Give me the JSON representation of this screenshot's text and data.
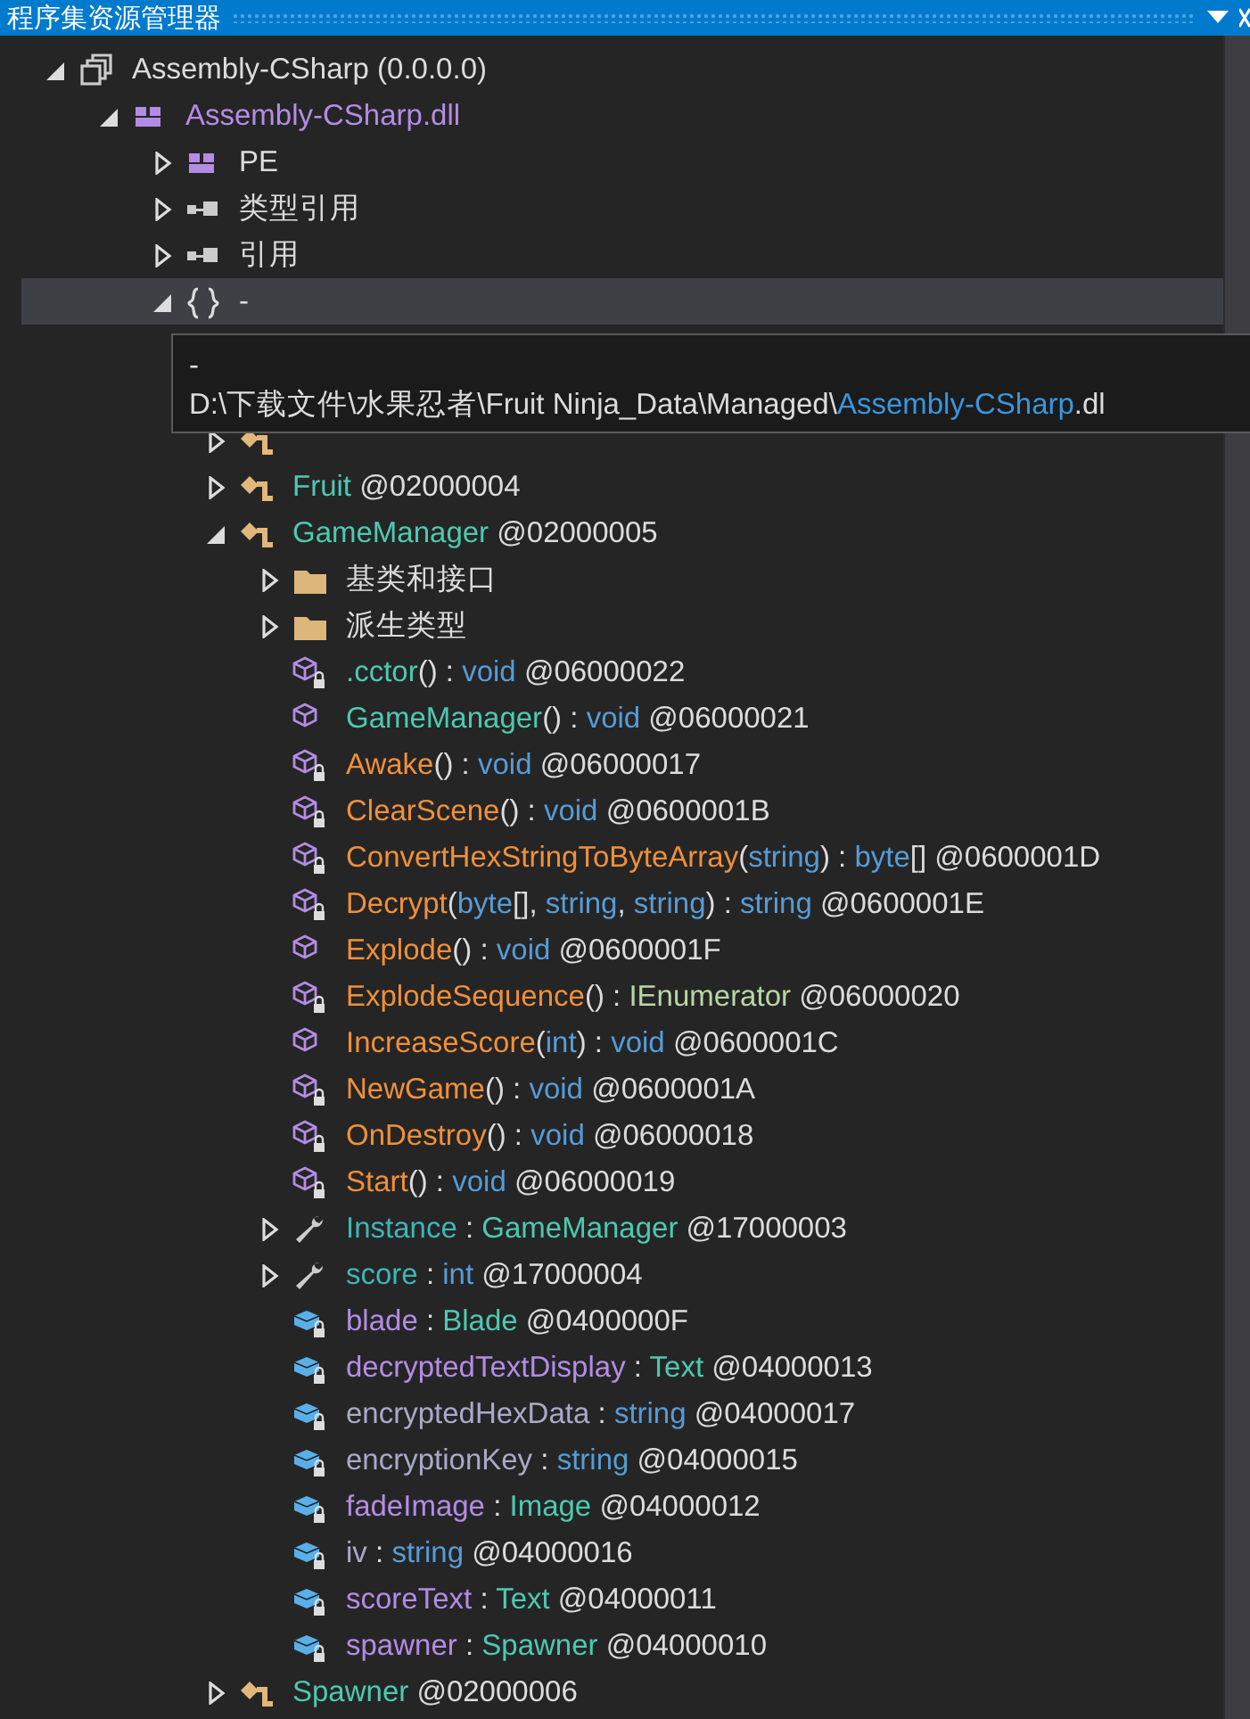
{
  "window": {
    "title": "程序集资源管理器"
  },
  "tree": [
    {
      "kind": "assembly",
      "expanded": true,
      "selected": false,
      "label": [
        {
          "t": "Assembly-CSharp (0.0.0.0)",
          "kind": "plain"
        }
      ],
      "children": [
        {
          "kind": "module",
          "expanded": true,
          "selected": false,
          "label": [
            {
              "t": "Assembly-CSharp.dll",
              "kind": "field"
            }
          ],
          "children": [
            {
              "kind": "module",
              "expanded": false,
              "selected": false,
              "label": [
                {
                  "t": "PE",
                  "kind": "plain"
                }
              ]
            },
            {
              "kind": "refs",
              "expanded": false,
              "selected": false,
              "label": [
                {
                  "t": "类型引用",
                  "kind": "plain"
                }
              ]
            },
            {
              "kind": "refs",
              "expanded": false,
              "selected": false,
              "label": [
                {
                  "t": "引用",
                  "kind": "plain"
                }
              ]
            },
            {
              "kind": "namespace",
              "expanded": true,
              "selected": true,
              "label": [
                {
                  "t": "-",
                  "kind": "plain"
                }
              ],
              "children": [
                {
                  "kind": "class",
                  "expanded": false,
                  "selected": false
                },
                {
                  "kind": "class",
                  "expanded": false,
                  "selected": false,
                  "label": [
                    {
                      "t": "Fruit",
                      "kind": "type"
                    },
                    {
                      "t": " @02000004",
                      "kind": "plain"
                    }
                  ]
                },
                {
                  "kind": "class",
                  "expanded": true,
                  "selected": false,
                  "label": [
                    {
                      "t": "GameManager",
                      "kind": "type"
                    },
                    {
                      "t": " @02000005",
                      "kind": "plain"
                    }
                  ],
                  "children": [
                    {
                      "kind": "folder",
                      "expanded": false,
                      "selected": false,
                      "label": [
                        {
                          "t": "基类和接口",
                          "kind": "plain"
                        }
                      ]
                    },
                    {
                      "kind": "folder",
                      "expanded": false,
                      "selected": false,
                      "label": [
                        {
                          "t": "派生类型",
                          "kind": "plain"
                        }
                      ]
                    },
                    {
                      "kind": "method",
                      "locked": true,
                      "selected": false,
                      "label": [
                        {
                          "t": ".cctor",
                          "kind": "type"
                        },
                        {
                          "t": "() : ",
                          "kind": "plain"
                        },
                        {
                          "t": "void",
                          "kind": "keyword"
                        },
                        {
                          "t": " @06000022",
                          "kind": "plain"
                        }
                      ]
                    },
                    {
                      "kind": "method",
                      "locked": false,
                      "selected": false,
                      "label": [
                        {
                          "t": "GameManager",
                          "kind": "type"
                        },
                        {
                          "t": "() : ",
                          "kind": "plain"
                        },
                        {
                          "t": "void",
                          "kind": "keyword"
                        },
                        {
                          "t": " @06000021",
                          "kind": "plain"
                        }
                      ]
                    },
                    {
                      "kind": "method",
                      "locked": true,
                      "selected": false,
                      "label": [
                        {
                          "t": "Awake",
                          "kind": "method"
                        },
                        {
                          "t": "() : ",
                          "kind": "plain"
                        },
                        {
                          "t": "void",
                          "kind": "keyword"
                        },
                        {
                          "t": " @06000017",
                          "kind": "plain"
                        }
                      ]
                    },
                    {
                      "kind": "method",
                      "locked": true,
                      "selected": false,
                      "label": [
                        {
                          "t": "ClearScene",
                          "kind": "method"
                        },
                        {
                          "t": "() : ",
                          "kind": "plain"
                        },
                        {
                          "t": "void",
                          "kind": "keyword"
                        },
                        {
                          "t": " @0600001B",
                          "kind": "plain"
                        }
                      ]
                    },
                    {
                      "kind": "method",
                      "locked": true,
                      "selected": false,
                      "label": [
                        {
                          "t": "ConvertHexStringToByteArray",
                          "kind": "method"
                        },
                        {
                          "t": "(",
                          "kind": "plain"
                        },
                        {
                          "t": "string",
                          "kind": "keyword"
                        },
                        {
                          "t": ") : ",
                          "kind": "plain"
                        },
                        {
                          "t": "byte",
                          "kind": "keyword"
                        },
                        {
                          "t": "[] @0600001D",
                          "kind": "plain"
                        }
                      ]
                    },
                    {
                      "kind": "method",
                      "locked": true,
                      "selected": false,
                      "label": [
                        {
                          "t": "Decrypt",
                          "kind": "method"
                        },
                        {
                          "t": "(",
                          "kind": "plain"
                        },
                        {
                          "t": "byte",
                          "kind": "keyword"
                        },
                        {
                          "t": "[], ",
                          "kind": "plain"
                        },
                        {
                          "t": "string",
                          "kind": "keyword"
                        },
                        {
                          "t": ", ",
                          "kind": "plain"
                        },
                        {
                          "t": "string",
                          "kind": "keyword"
                        },
                        {
                          "t": ") : ",
                          "kind": "plain"
                        },
                        {
                          "t": "string",
                          "kind": "keyword"
                        },
                        {
                          "t": " @0600001E",
                          "kind": "plain"
                        }
                      ]
                    },
                    {
                      "kind": "method",
                      "locked": false,
                      "selected": false,
                      "label": [
                        {
                          "t": "Explode",
                          "kind": "method"
                        },
                        {
                          "t": "() : ",
                          "kind": "plain"
                        },
                        {
                          "t": "void",
                          "kind": "keyword"
                        },
                        {
                          "t": " @0600001F",
                          "kind": "plain"
                        }
                      ]
                    },
                    {
                      "kind": "method",
                      "locked": true,
                      "selected": false,
                      "label": [
                        {
                          "t": "ExplodeSequence",
                          "kind": "method"
                        },
                        {
                          "t": "() : ",
                          "kind": "plain"
                        },
                        {
                          "t": "IEnumerator",
                          "kind": "interface"
                        },
                        {
                          "t": " @06000020",
                          "kind": "plain"
                        }
                      ]
                    },
                    {
                      "kind": "method",
                      "locked": false,
                      "selected": false,
                      "label": [
                        {
                          "t": "IncreaseScore",
                          "kind": "method"
                        },
                        {
                          "t": "(",
                          "kind": "plain"
                        },
                        {
                          "t": "int",
                          "kind": "keyword"
                        },
                        {
                          "t": ") : ",
                          "kind": "plain"
                        },
                        {
                          "t": "void",
                          "kind": "keyword"
                        },
                        {
                          "t": " @0600001C",
                          "kind": "plain"
                        }
                      ]
                    },
                    {
                      "kind": "method",
                      "locked": true,
                      "selected": false,
                      "label": [
                        {
                          "t": "NewGame",
                          "kind": "method"
                        },
                        {
                          "t": "() : ",
                          "kind": "plain"
                        },
                        {
                          "t": "void",
                          "kind": "keyword"
                        },
                        {
                          "t": " @0600001A",
                          "kind": "plain"
                        }
                      ]
                    },
                    {
                      "kind": "method",
                      "locked": true,
                      "selected": false,
                      "label": [
                        {
                          "t": "OnDestroy",
                          "kind": "method"
                        },
                        {
                          "t": "() : ",
                          "kind": "plain"
                        },
                        {
                          "t": "void",
                          "kind": "keyword"
                        },
                        {
                          "t": " @06000018",
                          "kind": "plain"
                        }
                      ]
                    },
                    {
                      "kind": "method",
                      "locked": true,
                      "selected": false,
                      "label": [
                        {
                          "t": "Start",
                          "kind": "method"
                        },
                        {
                          "t": "() : ",
                          "kind": "plain"
                        },
                        {
                          "t": "void",
                          "kind": "keyword"
                        },
                        {
                          "t": " @06000019",
                          "kind": "plain"
                        }
                      ]
                    },
                    {
                      "kind": "property",
                      "expanded": false,
                      "selected": false,
                      "label": [
                        {
                          "t": "Instance",
                          "kind": "property"
                        },
                        {
                          "t": " : ",
                          "kind": "plain"
                        },
                        {
                          "t": "GameManager",
                          "kind": "type"
                        },
                        {
                          "t": " @17000003",
                          "kind": "plain"
                        }
                      ]
                    },
                    {
                      "kind": "property",
                      "expanded": false,
                      "selected": false,
                      "label": [
                        {
                          "t": "score",
                          "kind": "property"
                        },
                        {
                          "t": " : ",
                          "kind": "plain"
                        },
                        {
                          "t": "int",
                          "kind": "keyword"
                        },
                        {
                          "t": " @17000004",
                          "kind": "plain"
                        }
                      ]
                    },
                    {
                      "kind": "field",
                      "locked": true,
                      "selected": false,
                      "label": [
                        {
                          "t": "blade",
                          "kind": "field"
                        },
                        {
                          "t": " : ",
                          "kind": "plain"
                        },
                        {
                          "t": "Blade",
                          "kind": "type"
                        },
                        {
                          "t": " @0400000F",
                          "kind": "plain"
                        }
                      ]
                    },
                    {
                      "kind": "field",
                      "locked": true,
                      "selected": false,
                      "label": [
                        {
                          "t": "decryptedTextDisplay",
                          "kind": "field"
                        },
                        {
                          "t": " : ",
                          "kind": "plain"
                        },
                        {
                          "t": "Text",
                          "kind": "type"
                        },
                        {
                          "t": " @04000013",
                          "kind": "plain"
                        }
                      ]
                    },
                    {
                      "kind": "field",
                      "locked": true,
                      "selected": false,
                      "label": [
                        {
                          "t": "encryptedHexData",
                          "kind": "readonly"
                        },
                        {
                          "t": " : ",
                          "kind": "plain"
                        },
                        {
                          "t": "string",
                          "kind": "keyword"
                        },
                        {
                          "t": " @04000017",
                          "kind": "plain"
                        }
                      ]
                    },
                    {
                      "kind": "field",
                      "locked": true,
                      "selected": false,
                      "label": [
                        {
                          "t": "encryptionKey",
                          "kind": "readonly"
                        },
                        {
                          "t": " : ",
                          "kind": "plain"
                        },
                        {
                          "t": "string",
                          "kind": "keyword"
                        },
                        {
                          "t": " @04000015",
                          "kind": "plain"
                        }
                      ]
                    },
                    {
                      "kind": "field",
                      "locked": true,
                      "selected": false,
                      "label": [
                        {
                          "t": "fadeImage",
                          "kind": "field"
                        },
                        {
                          "t": " : ",
                          "kind": "plain"
                        },
                        {
                          "t": "Image",
                          "kind": "type"
                        },
                        {
                          "t": " @04000012",
                          "kind": "plain"
                        }
                      ]
                    },
                    {
                      "kind": "field",
                      "locked": true,
                      "selected": false,
                      "label": [
                        {
                          "t": "iv",
                          "kind": "readonly"
                        },
                        {
                          "t": " : ",
                          "kind": "plain"
                        },
                        {
                          "t": "string",
                          "kind": "keyword"
                        },
                        {
                          "t": " @04000016",
                          "kind": "plain"
                        }
                      ]
                    },
                    {
                      "kind": "field",
                      "locked": true,
                      "selected": false,
                      "label": [
                        {
                          "t": "scoreText",
                          "kind": "field"
                        },
                        {
                          "t": " : ",
                          "kind": "plain"
                        },
                        {
                          "t": "Text",
                          "kind": "type"
                        },
                        {
                          "t": " @04000011",
                          "kind": "plain"
                        }
                      ]
                    },
                    {
                      "kind": "field",
                      "locked": true,
                      "selected": false,
                      "label": [
                        {
                          "t": "spawner",
                          "kind": "field"
                        },
                        {
                          "t": " : ",
                          "kind": "plain"
                        },
                        {
                          "t": "Spawner",
                          "kind": "type"
                        },
                        {
                          "t": " @04000010",
                          "kind": "plain"
                        }
                      ]
                    }
                  ]
                },
                {
                  "kind": "class",
                  "expanded": false,
                  "selected": false,
                  "label": [
                    {
                      "t": "Spawner",
                      "kind": "type"
                    },
                    {
                      "t": " @02000006",
                      "kind": "plain"
                    }
                  ]
                }
              ]
            }
          ]
        }
      ]
    }
  ],
  "tooltip": {
    "lines": [
      [
        {
          "t": "-",
          "kind": "plain"
        }
      ],
      [
        {
          "t": "D:\\下载文件\\水果忍者\\Fruit Ninja_Data\\Managed\\",
          "kind": "plain"
        },
        {
          "t": "Assembly-CSharp",
          "kind": "link"
        },
        {
          "t": ".dl",
          "kind": "plain"
        }
      ]
    ]
  }
}
